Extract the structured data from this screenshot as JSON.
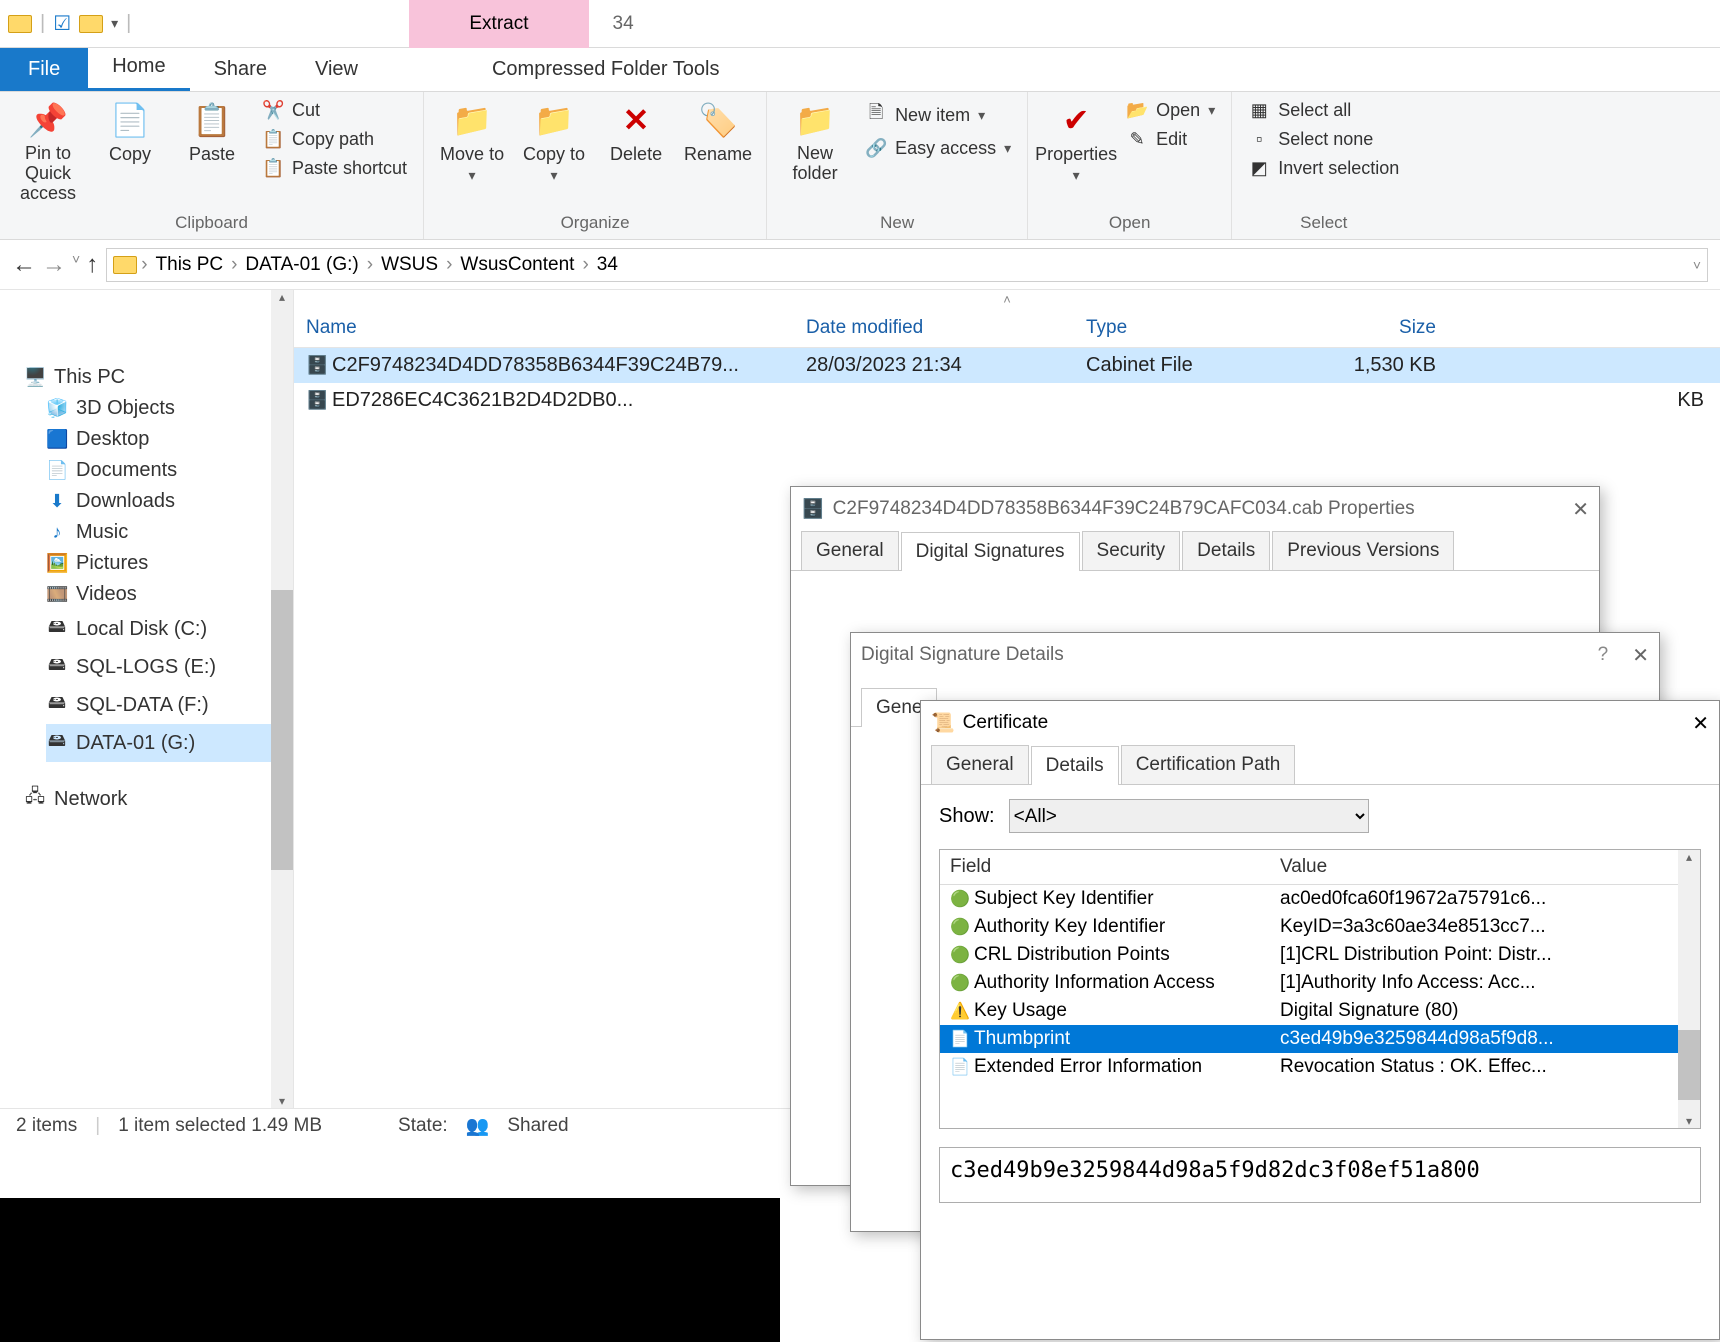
{
  "title": {
    "extract": "Extract",
    "doc": "34"
  },
  "tabs": {
    "file": "File",
    "home": "Home",
    "share": "Share",
    "view": "View",
    "context": "Compressed Folder Tools"
  },
  "ribbon": {
    "clipboard": {
      "pin": "Pin to Quick access",
      "copy": "Copy",
      "paste": "Paste",
      "cut": "Cut",
      "copypath": "Copy path",
      "pasteshortcut": "Paste shortcut",
      "label": "Clipboard"
    },
    "organize": {
      "moveto": "Move to",
      "copyto": "Copy to",
      "delete": "Delete",
      "rename": "Rename",
      "label": "Organize"
    },
    "new": {
      "newfolder": "New folder",
      "newitem": "New item",
      "easyaccess": "Easy access",
      "label": "New"
    },
    "open": {
      "properties": "Properties",
      "open": "Open",
      "edit": "Edit",
      "label": "Open"
    },
    "select": {
      "selectall": "Select all",
      "selectnone": "Select none",
      "invert": "Invert selection",
      "label": "Select"
    }
  },
  "breadcrumb": [
    "This PC",
    "DATA-01 (G:)",
    "WSUS",
    "WsusContent",
    "34"
  ],
  "columns": {
    "name": "Name",
    "modified": "Date modified",
    "type": "Type",
    "size": "Size"
  },
  "files": [
    {
      "name": "C2F9748234D4DD78358B6344F39C24B79...",
      "modified": "28/03/2023 21:34",
      "type": "Cabinet File",
      "size": "1,530 KB"
    },
    {
      "name": "ED7286EC4C3621B2D4D2DB0...",
      "modified": "",
      "type": "",
      "size": "KB"
    }
  ],
  "tree": {
    "thispc": "This PC",
    "objects3d": "3D Objects",
    "desktop": "Desktop",
    "documents": "Documents",
    "downloads": "Downloads",
    "music": "Music",
    "pictures": "Pictures",
    "videos": "Videos",
    "localc": "Local Disk (C:)",
    "sqllogs": "SQL-LOGS (E:)",
    "sqldata": "SQL-DATA (F:)",
    "data01": "DATA-01 (G:)",
    "network": "Network"
  },
  "status": {
    "items": "2 items",
    "selected": "1 item selected  1.49 MB",
    "state_label": "State:",
    "state": "Shared"
  },
  "props_dialog": {
    "title": "C2F9748234D4DD78358B6344F39C24B79CAFC034.cab Properties",
    "tabs": {
      "general": "General",
      "dsig": "Digital Signatures",
      "security": "Security",
      "details": "Details",
      "prev": "Previous Versions"
    }
  },
  "dsd_dialog": {
    "title": "Digital Signature Details",
    "tab_general": "Gene"
  },
  "cert_dialog": {
    "title": "Certificate",
    "tabs": {
      "general": "General",
      "details": "Details",
      "certpath": "Certification Path"
    },
    "show_label": "Show:",
    "show_value": "<All>",
    "hdr_field": "Field",
    "hdr_value": "Value",
    "rows": [
      {
        "field": "Subject Key Identifier",
        "value": "ac0ed0fca60f19672a75791c6..."
      },
      {
        "field": "Authority Key Identifier",
        "value": "KeyID=3a3c60ae34e8513cc7..."
      },
      {
        "field": "CRL Distribution Points",
        "value": "[1]CRL Distribution Point: Distr..."
      },
      {
        "field": "Authority Information Access",
        "value": "[1]Authority Info Access: Acc..."
      },
      {
        "field": "Key Usage",
        "value": "Digital Signature (80)"
      },
      {
        "field": "Thumbprint",
        "value": "c3ed49b9e3259844d98a5f9d8..."
      },
      {
        "field": "Extended Error Information",
        "value": "Revocation Status : OK. Effec..."
      }
    ],
    "selected_value": "c3ed49b9e3259844d98a5f9d82dc3f08ef51a800"
  }
}
